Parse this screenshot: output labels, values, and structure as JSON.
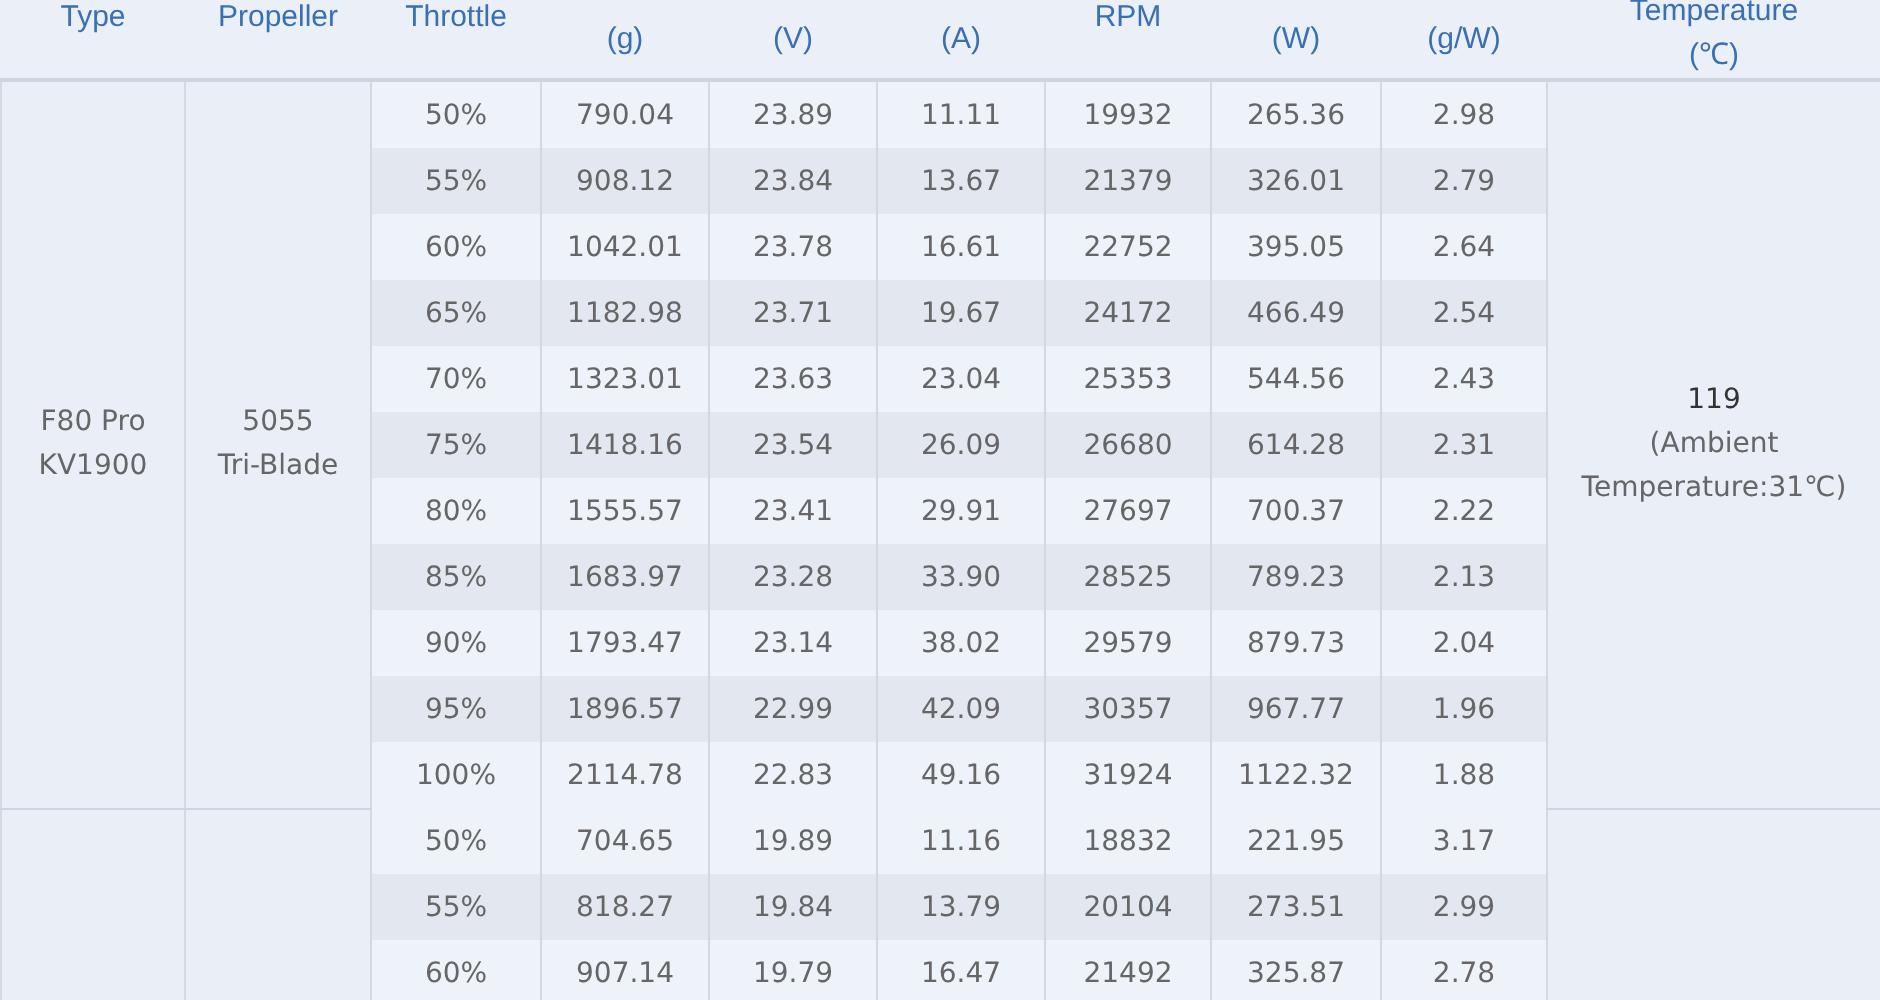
{
  "table": {
    "columns": [
      {
        "label": "Type"
      },
      {
        "label": "Propeller"
      },
      {
        "label": "Throttle"
      },
      {
        "unit": "(g)"
      },
      {
        "unit": "(V)"
      },
      {
        "unit": "(A)"
      },
      {
        "label": "RPM"
      },
      {
        "unit": "(W)"
      },
      {
        "unit": "(g/W)"
      },
      {
        "label": "Temperature",
        "unit": "(℃)"
      }
    ],
    "groups": [
      {
        "type": [
          "F80 Pro",
          "KV1900"
        ],
        "propeller": [
          "5055",
          "Tri-Blade"
        ],
        "temperature": {
          "value": "119",
          "note": "(Ambient Temperature:31℃)"
        },
        "rows": [
          [
            "50%",
            "790.04",
            "23.89",
            "11.11",
            "19932",
            "265.36",
            "2.98"
          ],
          [
            "55%",
            "908.12",
            "23.84",
            "13.67",
            "21379",
            "326.01",
            "2.79"
          ],
          [
            "60%",
            "1042.01",
            "23.78",
            "16.61",
            "22752",
            "395.05",
            "2.64"
          ],
          [
            "65%",
            "1182.98",
            "23.71",
            "19.67",
            "24172",
            "466.49",
            "2.54"
          ],
          [
            "70%",
            "1323.01",
            "23.63",
            "23.04",
            "25353",
            "544.56",
            "2.43"
          ],
          [
            "75%",
            "1418.16",
            "23.54",
            "26.09",
            "26680",
            "614.28",
            "2.31"
          ],
          [
            "80%",
            "1555.57",
            "23.41",
            "29.91",
            "27697",
            "700.37",
            "2.22"
          ],
          [
            "85%",
            "1683.97",
            "23.28",
            "33.90",
            "28525",
            "789.23",
            "2.13"
          ],
          [
            "90%",
            "1793.47",
            "23.14",
            "38.02",
            "29579",
            "879.73",
            "2.04"
          ],
          [
            "95%",
            "1896.57",
            "22.99",
            "42.09",
            "30357",
            "967.77",
            "1.96"
          ],
          [
            "100%",
            "2114.78",
            "22.83",
            "49.16",
            "31924",
            "1122.32",
            "1.88"
          ]
        ]
      },
      {
        "rows": [
          [
            "50%",
            "704.65",
            "19.89",
            "11.16",
            "18832",
            "221.95",
            "3.17"
          ],
          [
            "55%",
            "818.27",
            "19.84",
            "13.79",
            "20104",
            "273.51",
            "2.99"
          ],
          [
            "60%",
            "907.14",
            "19.79",
            "16.47",
            "21492",
            "325.87",
            "2.78"
          ]
        ]
      }
    ]
  }
}
